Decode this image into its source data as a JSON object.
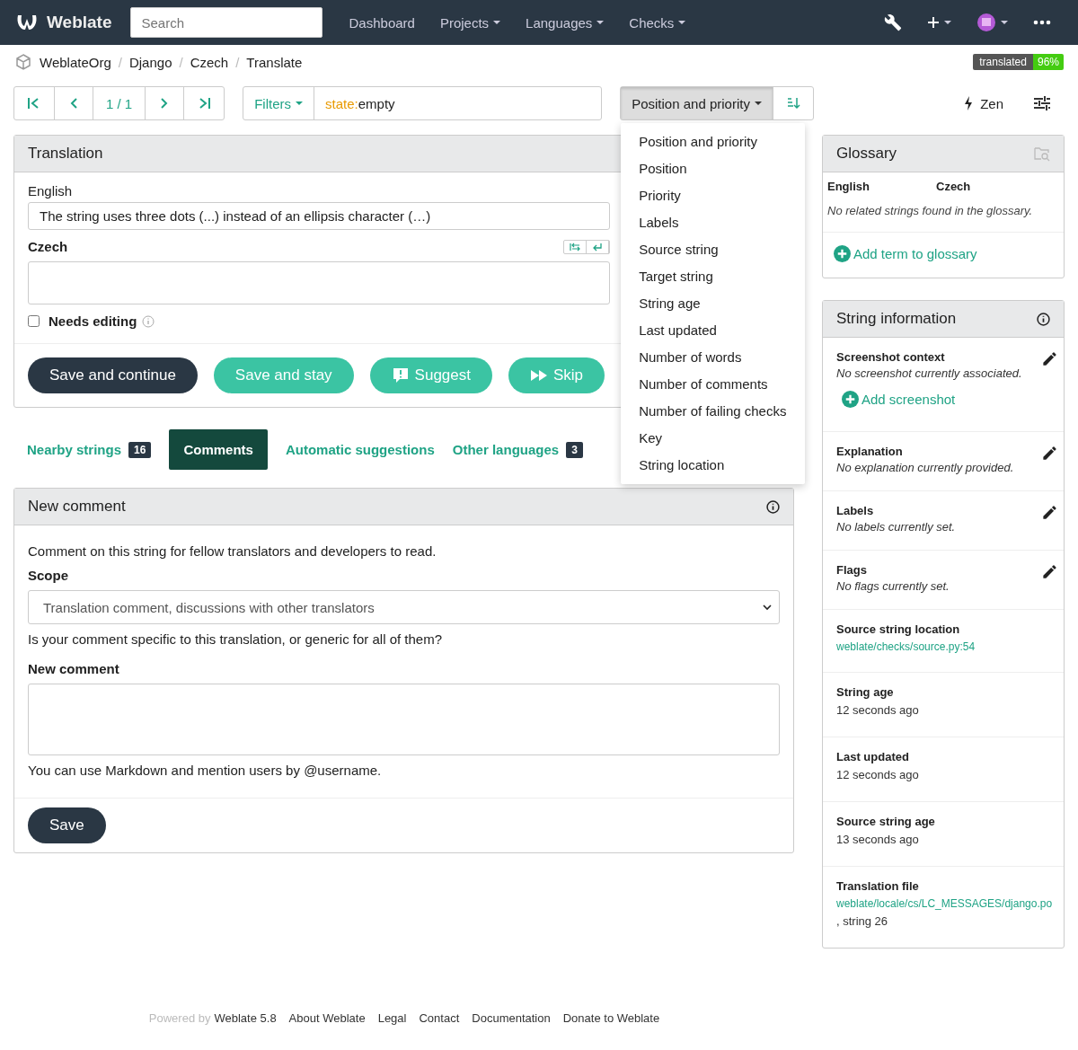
{
  "navbar": {
    "brand": "Weblate",
    "search": {
      "placeholder": "Search"
    },
    "menu": [
      {
        "label": "Dashboard",
        "dropdown": false
      },
      {
        "label": "Projects",
        "dropdown": true
      },
      {
        "label": "Languages",
        "dropdown": true
      },
      {
        "label": "Checks",
        "dropdown": true
      }
    ]
  },
  "breadcrumb": {
    "separator": "/",
    "items": [
      "WeblateOrg",
      "Django",
      "Czech",
      "Translate"
    ]
  },
  "progress_badge": {
    "label": "translated",
    "value": "96%"
  },
  "pager": {
    "position": "1 / 1"
  },
  "filter": {
    "button": "Filters",
    "query_key": "state:",
    "query_value": "empty"
  },
  "sort": {
    "label": "Position and priority",
    "pressed": true,
    "options": [
      {
        "label": "Position and priority"
      },
      {
        "label": "Position"
      },
      {
        "label": "Priority"
      },
      {
        "label": "Labels"
      },
      {
        "label": "Source string"
      },
      {
        "label": "Target string"
      },
      {
        "label": "String age"
      },
      {
        "label": "Last updated"
      },
      {
        "label": "Number of words"
      },
      {
        "label": "Number of comments"
      },
      {
        "label": "Number of failing checks"
      },
      {
        "label": "Key"
      },
      {
        "label": "String location"
      }
    ]
  },
  "zen": {
    "label": "Zen"
  },
  "translation": {
    "title": "Translation",
    "source_label": "English",
    "source_text": "The string uses three dots (...) instead of an ellipsis character (…)",
    "target_label": "Czech",
    "needs_editing": {
      "label": "Needs editing",
      "checked": false
    },
    "buttons": [
      {
        "label": "Save and continue",
        "kind": "primary"
      },
      {
        "label": "Save and stay",
        "kind": "secondary"
      },
      {
        "label": "Suggest",
        "kind": "suggest"
      },
      {
        "label": "Skip",
        "kind": "skip"
      }
    ]
  },
  "tabs": [
    {
      "label": "Nearby strings",
      "count": "16",
      "selected": false
    },
    {
      "label": "Comments",
      "selected": true
    },
    {
      "label": "Automatic suggestions",
      "selected": false
    },
    {
      "label": "Other languages",
      "count": "3",
      "selected": false
    }
  ],
  "new_comment": {
    "title": "New comment",
    "intro": "Comment on this string for fellow translators and developers to read.",
    "scope_label": "Scope",
    "scope_value": "Translation comment, discussions with other translators",
    "scope_help": "Is your comment specific to this translation, or generic for all of them?",
    "comment_label": "New comment",
    "comment_help": "You can use Markdown and mention users by @username.",
    "save": "Save"
  },
  "glossary": {
    "title": "Glossary",
    "columns": [
      "English",
      "Czech"
    ],
    "empty": "No related strings found in the glossary.",
    "add": "Add term to glossary"
  },
  "string_info": {
    "title": "String information",
    "items": [
      {
        "label": "Screenshot context",
        "value": "No screenshot currently associated.",
        "kind": "note",
        "editable": true,
        "add": "Add screenshot"
      },
      {
        "label": "Explanation",
        "value": "No explanation currently provided.",
        "kind": "note",
        "editable": true
      },
      {
        "label": "Labels",
        "value": "No labels currently set.",
        "kind": "note",
        "editable": true
      },
      {
        "label": "Flags",
        "value": "No flags currently set.",
        "kind": "note",
        "editable": true
      },
      {
        "label": "Source string location",
        "value": "weblate/checks/source.py:54",
        "kind": "link",
        "editable": false
      },
      {
        "label": "String age",
        "value": "12 seconds ago",
        "kind": "text",
        "editable": false
      },
      {
        "label": "Last updated",
        "value": "12 seconds ago",
        "kind": "text",
        "editable": false
      },
      {
        "label": "Source string age",
        "value": "13 seconds ago",
        "kind": "text",
        "editable": false
      },
      {
        "label": "Translation file",
        "value": "weblate/locale/cs/LC_MESSAGES/django.po",
        "suffix": ", string 26",
        "kind": "link",
        "editable": false
      }
    ]
  },
  "footer": {
    "powered_by": "Powered by",
    "version": "Weblate 5.8",
    "links": [
      "About Weblate",
      "Legal",
      "Contact",
      "Documentation",
      "Donate to Weblate"
    ]
  }
}
